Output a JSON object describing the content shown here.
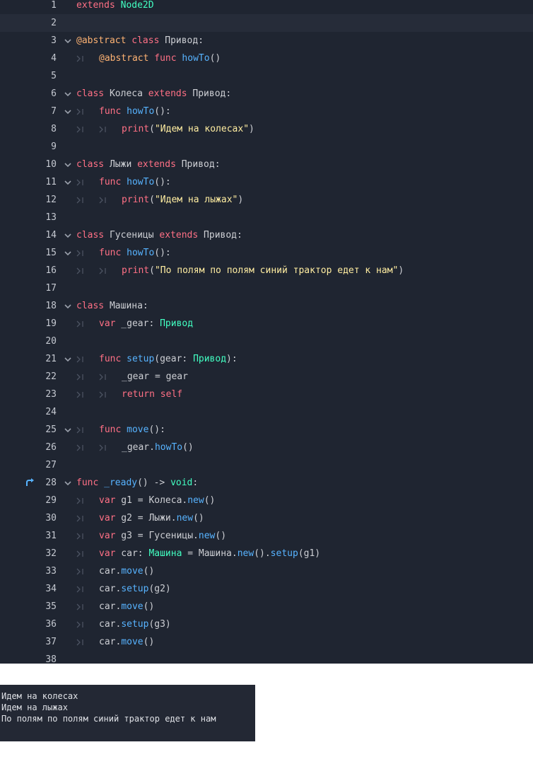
{
  "editor": {
    "current_line": 2,
    "colors": {
      "background": "#1f2531",
      "keyword": "#ff7085",
      "function": "#57b3ff",
      "type": "#42ffc2",
      "string": "#ffeda1",
      "annotation": "#ffb373"
    },
    "lines": [
      {
        "n": "1",
        "indent": 0,
        "fold": false,
        "tokens": [
          [
            "kw",
            "extends"
          ],
          [
            "p",
            " "
          ],
          [
            "ty",
            "Node2D"
          ]
        ]
      },
      {
        "n": "2",
        "indent": 0,
        "fold": false,
        "tokens": []
      },
      {
        "n": "3",
        "indent": 0,
        "fold": true,
        "tokens": [
          [
            "ann",
            "@abstract"
          ],
          [
            "p",
            " "
          ],
          [
            "kw",
            "class"
          ],
          [
            "p",
            " Привод:"
          ]
        ]
      },
      {
        "n": "4",
        "indent": 1,
        "fold": false,
        "tokens": [
          [
            "ann",
            "@abstract"
          ],
          [
            "p",
            " "
          ],
          [
            "kw",
            "func"
          ],
          [
            "p",
            " "
          ],
          [
            "fn",
            "howTo"
          ],
          [
            "p",
            "()"
          ]
        ]
      },
      {
        "n": "5",
        "indent": 0,
        "fold": false,
        "tokens": []
      },
      {
        "n": "6",
        "indent": 0,
        "fold": true,
        "tokens": [
          [
            "kw",
            "class"
          ],
          [
            "p",
            " Колеса "
          ],
          [
            "kw",
            "extends"
          ],
          [
            "p",
            " Привод:"
          ]
        ]
      },
      {
        "n": "7",
        "indent": 1,
        "fold": true,
        "tokens": [
          [
            "kw",
            "func"
          ],
          [
            "p",
            " "
          ],
          [
            "fn",
            "howTo"
          ],
          [
            "p",
            "():"
          ]
        ]
      },
      {
        "n": "8",
        "indent": 2,
        "fold": false,
        "tokens": [
          [
            "fk",
            "print"
          ],
          [
            "p",
            "("
          ],
          [
            "str",
            "\"Идем на колесах\""
          ],
          [
            "p",
            ")"
          ]
        ]
      },
      {
        "n": "9",
        "indent": 0,
        "fold": false,
        "tokens": []
      },
      {
        "n": "10",
        "indent": 0,
        "fold": true,
        "tokens": [
          [
            "kw",
            "class"
          ],
          [
            "p",
            " Лыжи "
          ],
          [
            "kw",
            "extends"
          ],
          [
            "p",
            " Привод:"
          ]
        ]
      },
      {
        "n": "11",
        "indent": 1,
        "fold": true,
        "tokens": [
          [
            "kw",
            "func"
          ],
          [
            "p",
            " "
          ],
          [
            "fn",
            "howTo"
          ],
          [
            "p",
            "():"
          ]
        ]
      },
      {
        "n": "12",
        "indent": 2,
        "fold": false,
        "tokens": [
          [
            "fk",
            "print"
          ],
          [
            "p",
            "("
          ],
          [
            "str",
            "\"Идем на лыжах\""
          ],
          [
            "p",
            ")"
          ]
        ]
      },
      {
        "n": "13",
        "indent": 0,
        "fold": false,
        "tokens": []
      },
      {
        "n": "14",
        "indent": 0,
        "fold": true,
        "tokens": [
          [
            "kw",
            "class"
          ],
          [
            "p",
            " Гусеницы "
          ],
          [
            "kw",
            "extends"
          ],
          [
            "p",
            " Привод:"
          ]
        ]
      },
      {
        "n": "15",
        "indent": 1,
        "fold": true,
        "tokens": [
          [
            "kw",
            "func"
          ],
          [
            "p",
            " "
          ],
          [
            "fn",
            "howTo"
          ],
          [
            "p",
            "():"
          ]
        ]
      },
      {
        "n": "16",
        "indent": 2,
        "fold": false,
        "tokens": [
          [
            "fk",
            "print"
          ],
          [
            "p",
            "("
          ],
          [
            "str",
            "\"По полям по полям синий трактор едет к нам\""
          ],
          [
            "p",
            ")"
          ]
        ]
      },
      {
        "n": "17",
        "indent": 0,
        "fold": false,
        "tokens": []
      },
      {
        "n": "18",
        "indent": 0,
        "fold": true,
        "tokens": [
          [
            "kw",
            "class"
          ],
          [
            "p",
            " Машина:"
          ]
        ]
      },
      {
        "n": "19",
        "indent": 1,
        "fold": false,
        "tokens": [
          [
            "kw",
            "var"
          ],
          [
            "p",
            " _gear: "
          ],
          [
            "ty",
            "Привод"
          ]
        ]
      },
      {
        "n": "20",
        "indent": 0,
        "fold": false,
        "tokens": []
      },
      {
        "n": "21",
        "indent": 1,
        "fold": true,
        "tokens": [
          [
            "kw",
            "func"
          ],
          [
            "p",
            " "
          ],
          [
            "fn",
            "setup"
          ],
          [
            "p",
            "(gear: "
          ],
          [
            "ty",
            "Привод"
          ],
          [
            "p",
            "):"
          ]
        ]
      },
      {
        "n": "22",
        "indent": 2,
        "fold": false,
        "tokens": [
          [
            "p",
            "_gear = gear"
          ]
        ]
      },
      {
        "n": "23",
        "indent": 2,
        "fold": false,
        "tokens": [
          [
            "kw",
            "return"
          ],
          [
            "p",
            " "
          ],
          [
            "kw",
            "self"
          ]
        ]
      },
      {
        "n": "24",
        "indent": 0,
        "fold": false,
        "tokens": []
      },
      {
        "n": "25",
        "indent": 1,
        "fold": true,
        "tokens": [
          [
            "kw",
            "func"
          ],
          [
            "p",
            " "
          ],
          [
            "fn",
            "move"
          ],
          [
            "p",
            "():"
          ]
        ]
      },
      {
        "n": "26",
        "indent": 2,
        "fold": false,
        "tokens": [
          [
            "p",
            "_gear."
          ],
          [
            "fn",
            "howTo"
          ],
          [
            "p",
            "()"
          ]
        ]
      },
      {
        "n": "27",
        "indent": 0,
        "fold": false,
        "tokens": []
      },
      {
        "n": "28",
        "indent": 0,
        "fold": true,
        "marker": "override-arrow-icon",
        "tokens": [
          [
            "kw",
            "func"
          ],
          [
            "p",
            " "
          ],
          [
            "fn",
            "_ready"
          ],
          [
            "p",
            "() -> "
          ],
          [
            "ty",
            "void"
          ],
          [
            "p",
            ":"
          ]
        ]
      },
      {
        "n": "29",
        "indent": 1,
        "fold": false,
        "tokens": [
          [
            "kw",
            "var"
          ],
          [
            "p",
            " g1 = Колеса."
          ],
          [
            "fn",
            "new"
          ],
          [
            "p",
            "()"
          ]
        ]
      },
      {
        "n": "30",
        "indent": 1,
        "fold": false,
        "tokens": [
          [
            "kw",
            "var"
          ],
          [
            "p",
            " g2 = Лыжи."
          ],
          [
            "fn",
            "new"
          ],
          [
            "p",
            "()"
          ]
        ]
      },
      {
        "n": "31",
        "indent": 1,
        "fold": false,
        "tokens": [
          [
            "kw",
            "var"
          ],
          [
            "p",
            " g3 = Гусеницы."
          ],
          [
            "fn",
            "new"
          ],
          [
            "p",
            "()"
          ]
        ]
      },
      {
        "n": "32",
        "indent": 1,
        "fold": false,
        "tokens": [
          [
            "kw",
            "var"
          ],
          [
            "p",
            " car: "
          ],
          [
            "ty",
            "Машина"
          ],
          [
            "p",
            " = Машина."
          ],
          [
            "fn",
            "new"
          ],
          [
            "p",
            "()."
          ],
          [
            "fn",
            "setup"
          ],
          [
            "p",
            "(g1)"
          ]
        ]
      },
      {
        "n": "33",
        "indent": 1,
        "fold": false,
        "tokens": [
          [
            "p",
            "car."
          ],
          [
            "fn",
            "move"
          ],
          [
            "p",
            "()"
          ]
        ]
      },
      {
        "n": "34",
        "indent": 1,
        "fold": false,
        "tokens": [
          [
            "p",
            "car."
          ],
          [
            "fn",
            "setup"
          ],
          [
            "p",
            "(g2)"
          ]
        ]
      },
      {
        "n": "35",
        "indent": 1,
        "fold": false,
        "tokens": [
          [
            "p",
            "car."
          ],
          [
            "fn",
            "move"
          ],
          [
            "p",
            "()"
          ]
        ]
      },
      {
        "n": "36",
        "indent": 1,
        "fold": false,
        "tokens": [
          [
            "p",
            "car."
          ],
          [
            "fn",
            "setup"
          ],
          [
            "p",
            "(g3)"
          ]
        ]
      },
      {
        "n": "37",
        "indent": 1,
        "fold": false,
        "tokens": [
          [
            "p",
            "car."
          ],
          [
            "fn",
            "move"
          ],
          [
            "p",
            "()"
          ]
        ]
      },
      {
        "n": "38",
        "indent": 0,
        "fold": false,
        "tokens": []
      }
    ]
  },
  "console": {
    "lines": [
      "Идем на колесах",
      "Идем на лыжах",
      "По полям по полям синий трактор едет к нам"
    ]
  }
}
